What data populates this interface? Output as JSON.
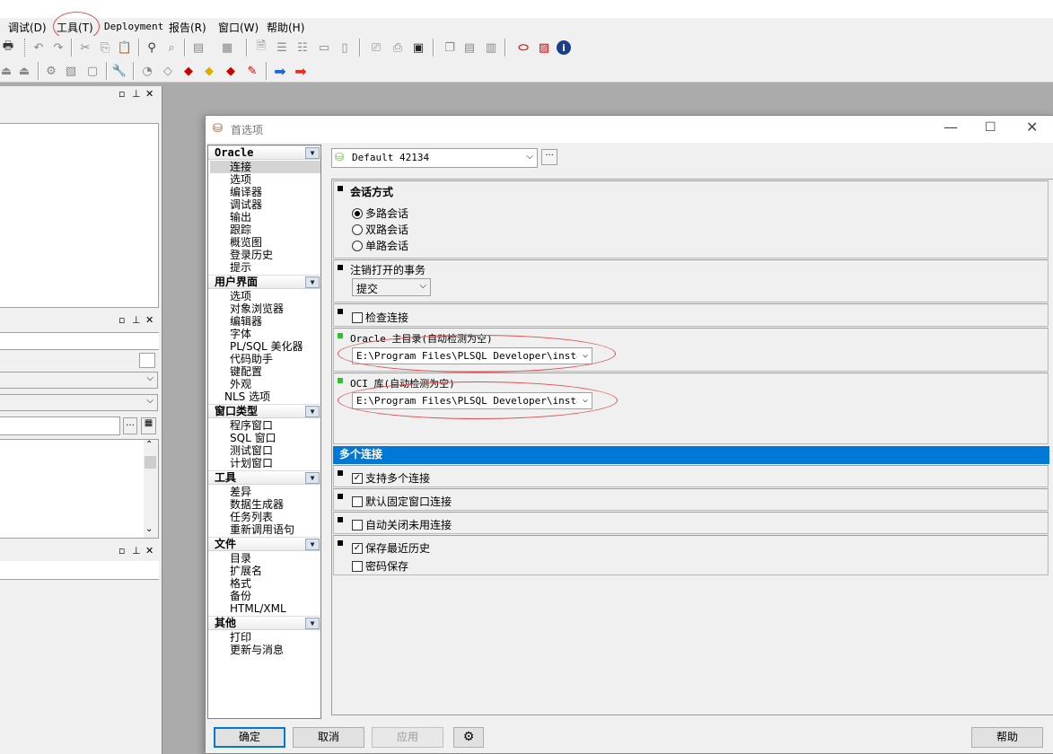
{
  "menu": [
    "调试(D)",
    "工具(T)",
    "Deployment",
    "报告(R)",
    "窗口(W)",
    "帮助(H)"
  ],
  "dialog": {
    "title": "首选项",
    "profile": "Default 42134",
    "nav": [
      {
        "cat": "Oracle",
        "items": [
          "连接",
          "选项",
          "编译器",
          "调试器",
          "输出",
          "跟踪",
          "概览图",
          "登录历史",
          "提示"
        ]
      },
      {
        "cat": "用户界面",
        "items": [
          "选项",
          "对象浏览器",
          "编辑器",
          "字体",
          "PL/SQL 美化器",
          "代码助手",
          "键配置",
          "外观",
          "NLS 选项"
        ]
      },
      {
        "cat": "窗口类型",
        "items": [
          "程序窗口",
          "SQL 窗口",
          "测试窗口",
          "计划窗口"
        ]
      },
      {
        "cat": "工具",
        "items": [
          "差异",
          "数据生成器",
          "任务列表",
          "重新调用语句"
        ]
      },
      {
        "cat": "文件",
        "items": [
          "目录",
          "扩展名",
          "格式",
          "备份",
          "HTML/XML"
        ]
      },
      {
        "cat": "其他",
        "items": [
          "打印",
          "更新与消息"
        ]
      }
    ],
    "session": {
      "title": "会话方式",
      "options": [
        "多路会话",
        "双路会话",
        "单路会话"
      ],
      "selected": 0
    },
    "logoff": {
      "title": "注销打开的事务",
      "value": "提交"
    },
    "check_conn": {
      "label": "检查连接",
      "checked": false
    },
    "oracle_home": {
      "label": "Oracle 主目录(自动检测为空)",
      "value": "E:\\Program Files\\PLSQL Developer\\instantc"
    },
    "oci": {
      "label": "OCI 库(自动检测为空)",
      "value": "E:\\Program Files\\PLSQL Developer\\instantc"
    },
    "multi": {
      "header": "多个连接",
      "support": {
        "label": "支持多个连接",
        "checked": true
      },
      "fixed": {
        "label": "默认固定窗口连接",
        "checked": false
      },
      "autoclose": {
        "label": "自动关闭未用连接",
        "checked": false
      },
      "history": {
        "label": "保存最近历史",
        "checked": true
      },
      "password": {
        "label": "密码保存",
        "checked": false
      }
    },
    "buttons": {
      "ok": "确定",
      "cancel": "取消",
      "apply": "应用",
      "help": "帮助"
    }
  }
}
